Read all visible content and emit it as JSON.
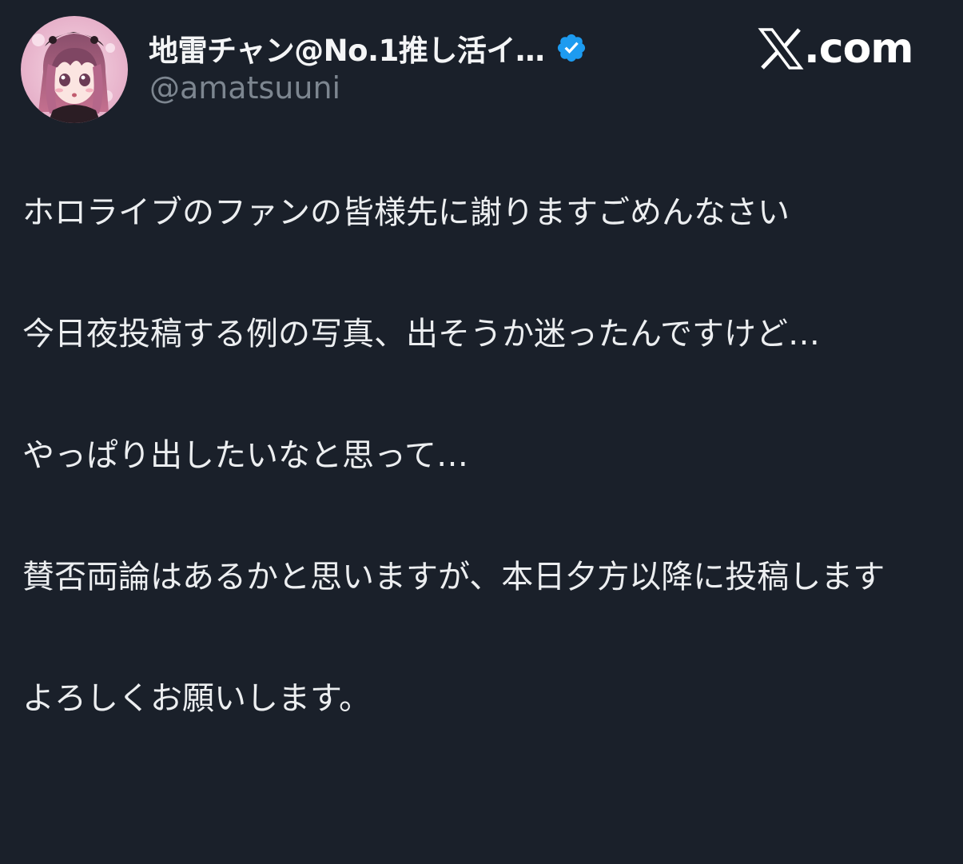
{
  "author": {
    "display_name": "地雷チャン@No.1推し活イ…",
    "handle": "@amatsuuni",
    "verified": true,
    "avatar_icon": "avatar-icon"
  },
  "brand": {
    "text": ".com",
    "logo_icon": "x-logo-icon"
  },
  "tweet": {
    "paragraphs": [
      "ホロライブのファンの皆様先に謝りますごめんなさい",
      "今日夜投稿する例の写真、出そうか迷ったんですけど…",
      "やっぱり出したいなと思って…",
      "賛否両論はあるかと思いますが、本日夕方以降に投稿します",
      "よろしくお願いします。"
    ]
  },
  "colors": {
    "background": "#1a202a",
    "text": "#eceef0",
    "muted": "#7d8690",
    "verified": "#1d9bf0"
  }
}
